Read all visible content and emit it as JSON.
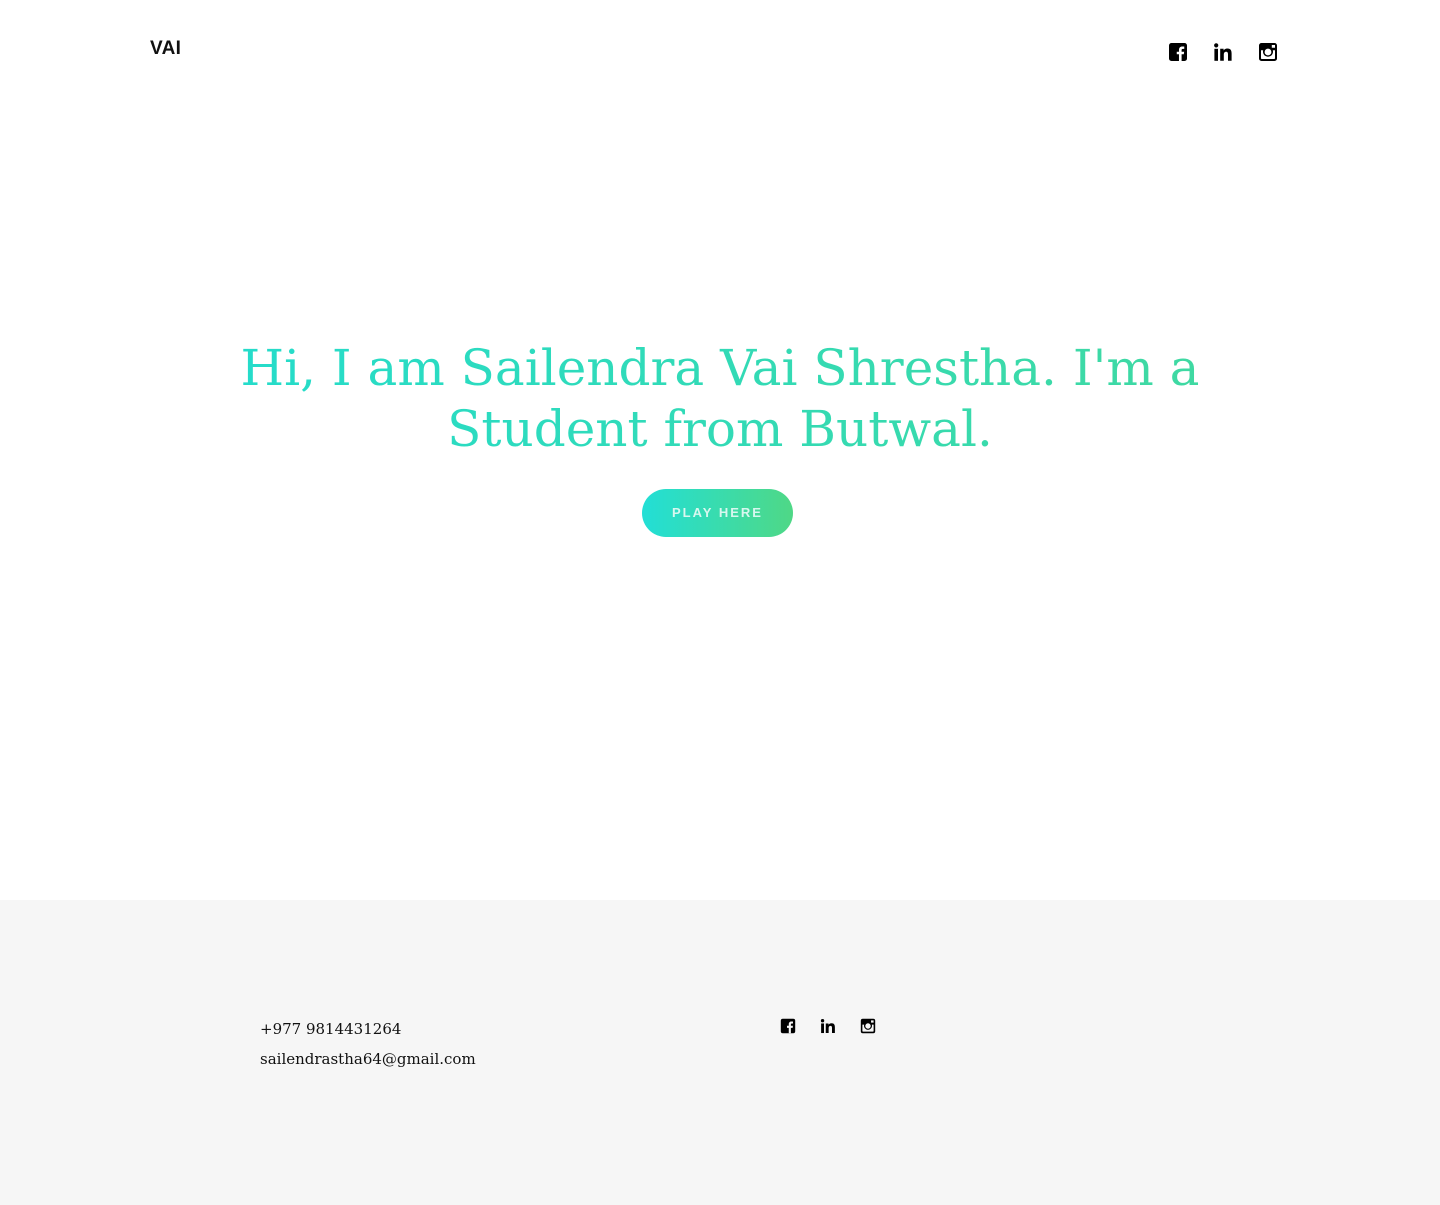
{
  "header": {
    "logo": "VAI",
    "social": [
      {
        "icon": "facebook-icon"
      },
      {
        "icon": "linkedin-icon"
      },
      {
        "icon": "instagram-icon"
      }
    ]
  },
  "hero": {
    "title": "Hi, I am Sailendra Vai Shrestha. I'm a Student from Butwal.",
    "button_label": "PLAY HERE"
  },
  "footer": {
    "phone": "+977 9814431264",
    "email": "sailendrastha64@gmail.com",
    "social": [
      {
        "icon": "facebook-icon"
      },
      {
        "icon": "linkedin-icon"
      },
      {
        "icon": "instagram-icon"
      }
    ]
  },
  "colors": {
    "accent_start": "#22dfd6",
    "accent_end": "#4fd886",
    "footer_background": "#f6f6f6",
    "text": "#111111"
  }
}
